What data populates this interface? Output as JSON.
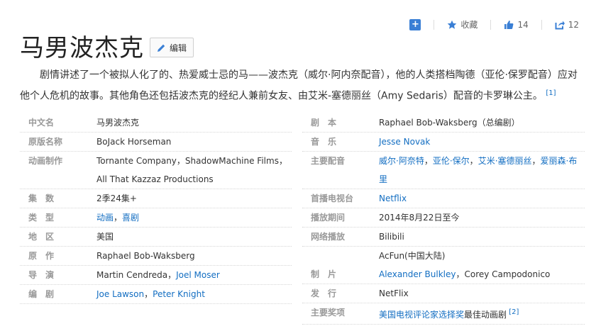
{
  "actions": {
    "collect_label": "收藏",
    "like_count": "14",
    "share_count": "12"
  },
  "title": "马男波杰克",
  "edit_label": "编辑",
  "summary": {
    "text": "剧情讲述了一个被拟人化了的、热爱威士忌的马——波杰克（威尔·阿内奈配音），他的人类搭档陶德（亚伦·保罗配音）应对他个人危机的故事。其他角色还包括波杰克的经纪人兼前女友、由艾米-塞德丽丝（Amy Sedaris）配音的卡罗琳公主。",
    "ref": "[1]"
  },
  "info_left": [
    {
      "key": "中文名",
      "value": "马男波杰克"
    },
    {
      "key": "原版名称",
      "value": "BoJack Horseman"
    },
    {
      "key": "动画制作",
      "value": "Tornante Company，ShadowMachine Films，All That Kazzaz Productions"
    },
    {
      "key": "集　数",
      "value": "2季24集+"
    },
    {
      "key": "类　型",
      "links": [
        "动画",
        "喜剧"
      ]
    },
    {
      "key": "地　区",
      "value": "美国"
    },
    {
      "key": "原　作",
      "value": "Raphael Bob-Waksberg"
    },
    {
      "key": "导　演",
      "value": "Martin Cendreda，",
      "links": [
        "Joel Moser"
      ]
    },
    {
      "key": "编　剧",
      "links": [
        "Joe Lawson",
        "Peter Knight"
      ]
    }
  ],
  "info_right": [
    {
      "key": "剧　本",
      "value": "Raphael Bob-Waksberg（总编剧）"
    },
    {
      "key": "音　乐",
      "links": [
        "Jesse Novak"
      ]
    },
    {
      "key": "主要配音",
      "links": [
        "威尔·阿奈特",
        "亚伦·保尔",
        "艾米·塞德丽丝",
        "爱丽森·布里"
      ]
    },
    {
      "key": "首播电视台",
      "links": [
        "Netflix"
      ]
    },
    {
      "key": "播放期间",
      "value": "2014年8月22日至今"
    },
    {
      "key": "网络播放",
      "value": "Bilibili"
    },
    {
      "key": "",
      "value": "AcFun(中国大陆)"
    },
    {
      "key": "制　片",
      "links": [
        "Alexander Bulkley"
      ],
      "value": "，Corey Campodonico"
    },
    {
      "key": "发　行",
      "value": "NetFlix"
    },
    {
      "key": "主要奖项",
      "links": [
        "美国电视评论家选择奖"
      ],
      "value": "最佳动画剧",
      "ref": "[2]"
    }
  ]
}
